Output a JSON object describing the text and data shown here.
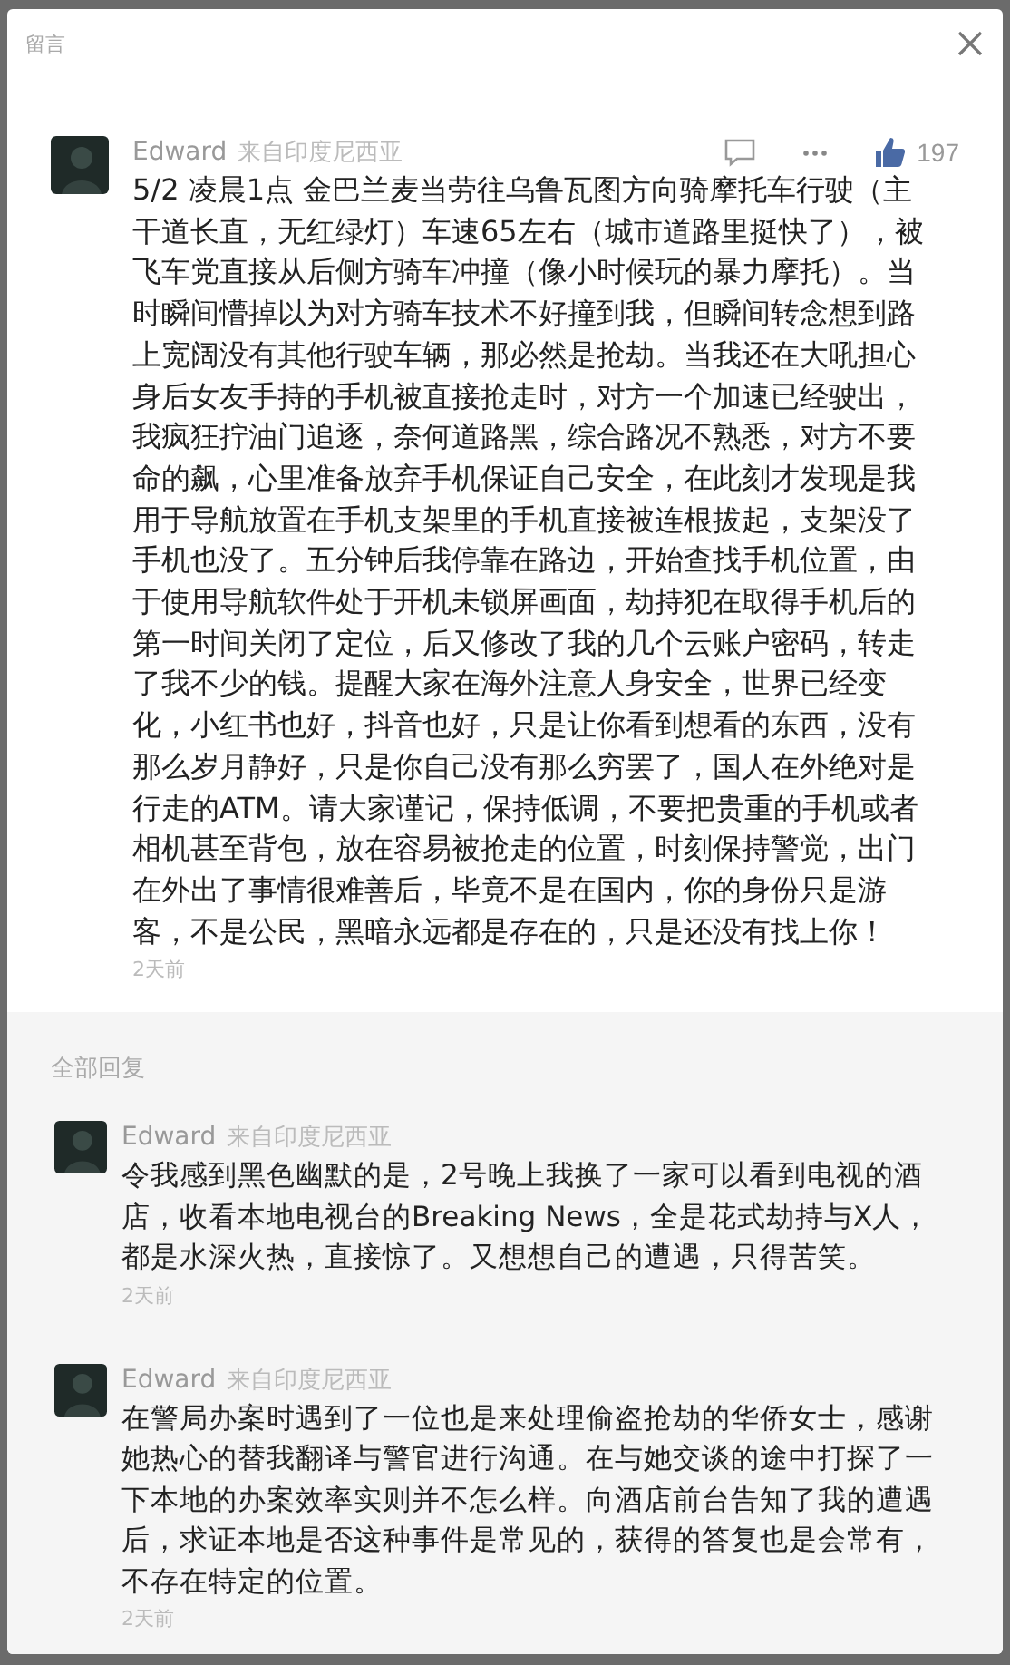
{
  "dialog": {
    "title": "留言"
  },
  "comment": {
    "author": "Edward",
    "location": "来自印度尼西亚",
    "likes": "197",
    "text": "5/2 凌晨1点 金巴兰麦当劳往乌鲁瓦图方向骑摩托车行驶（主干道长直，无红绿灯）车速65左右（城市道路里挺快了），被飞车党直接从后侧方骑车冲撞（像小时候玩的暴力摩托）。当时瞬间懵掉以为对方骑车技术不好撞到我，但瞬间转念想到路上宽阔没有其他行驶车辆，那必然是抢劫。当我还在大吼担心身后女友手持的手机被直接抢走时，对方一个加速已经驶出，我疯狂拧油门追逐，奈何道路黑，综合路况不熟悉，对方不要命的飙，心里准备放弃手机保证自己安全，在此刻才发现是我用于导航放置在手机支架里的手机直接被连根拔起，支架没了手机也没了。五分钟后我停靠在路边，开始查找手机位置，由于使用导航软件处于开机未锁屏画面，劫持犯在取得手机后的第一时间关闭了定位，后又修改了我的几个云账户密码，转走了我不少的钱。提醒大家在海外注意人身安全，世界已经变化，小红书也好，抖音也好，只是让你看到想看的东西，没有那么岁月静好，只是你自己没有那么穷罢了，国人在外绝对是行走的ATM。请大家谨记，保持低调，不要把贵重的手机或者相机甚至背包，放在容易被抢走的位置，时刻保持警觉，出门在外出了事情很难善后，毕竟不是在国内，你的身份只是游客，不是公民，黑暗永远都是存在的，只是还没有找上你！",
    "time": "2天前"
  },
  "replies_heading": "全部回复",
  "replies": [
    {
      "author": "Edward",
      "location": "来自印度尼西亚",
      "text": "令我感到黑色幽默的是，2号晚上我换了一家可以看到电视的酒店，收看本地电视台的Breaking News，全是花式劫持与X人，都是水深火热，直接惊了。又想想自己的遭遇，只得苦笑。",
      "time": "2天前"
    },
    {
      "author": "Edward",
      "location": "来自印度尼西亚",
      "text": "在警局办案时遇到了一位也是来处理偷盗抢劫的华侨女士，感谢她热心的替我翻译与警官进行沟通。在与她交谈的途中打探了一下本地的办案效率实则并不怎么样。向酒店前台告知了我的遭遇后，求证本地是否这种事件是常见的，获得的答复也是会常有，不存在特定的位置。",
      "time": "2天前"
    }
  ]
}
